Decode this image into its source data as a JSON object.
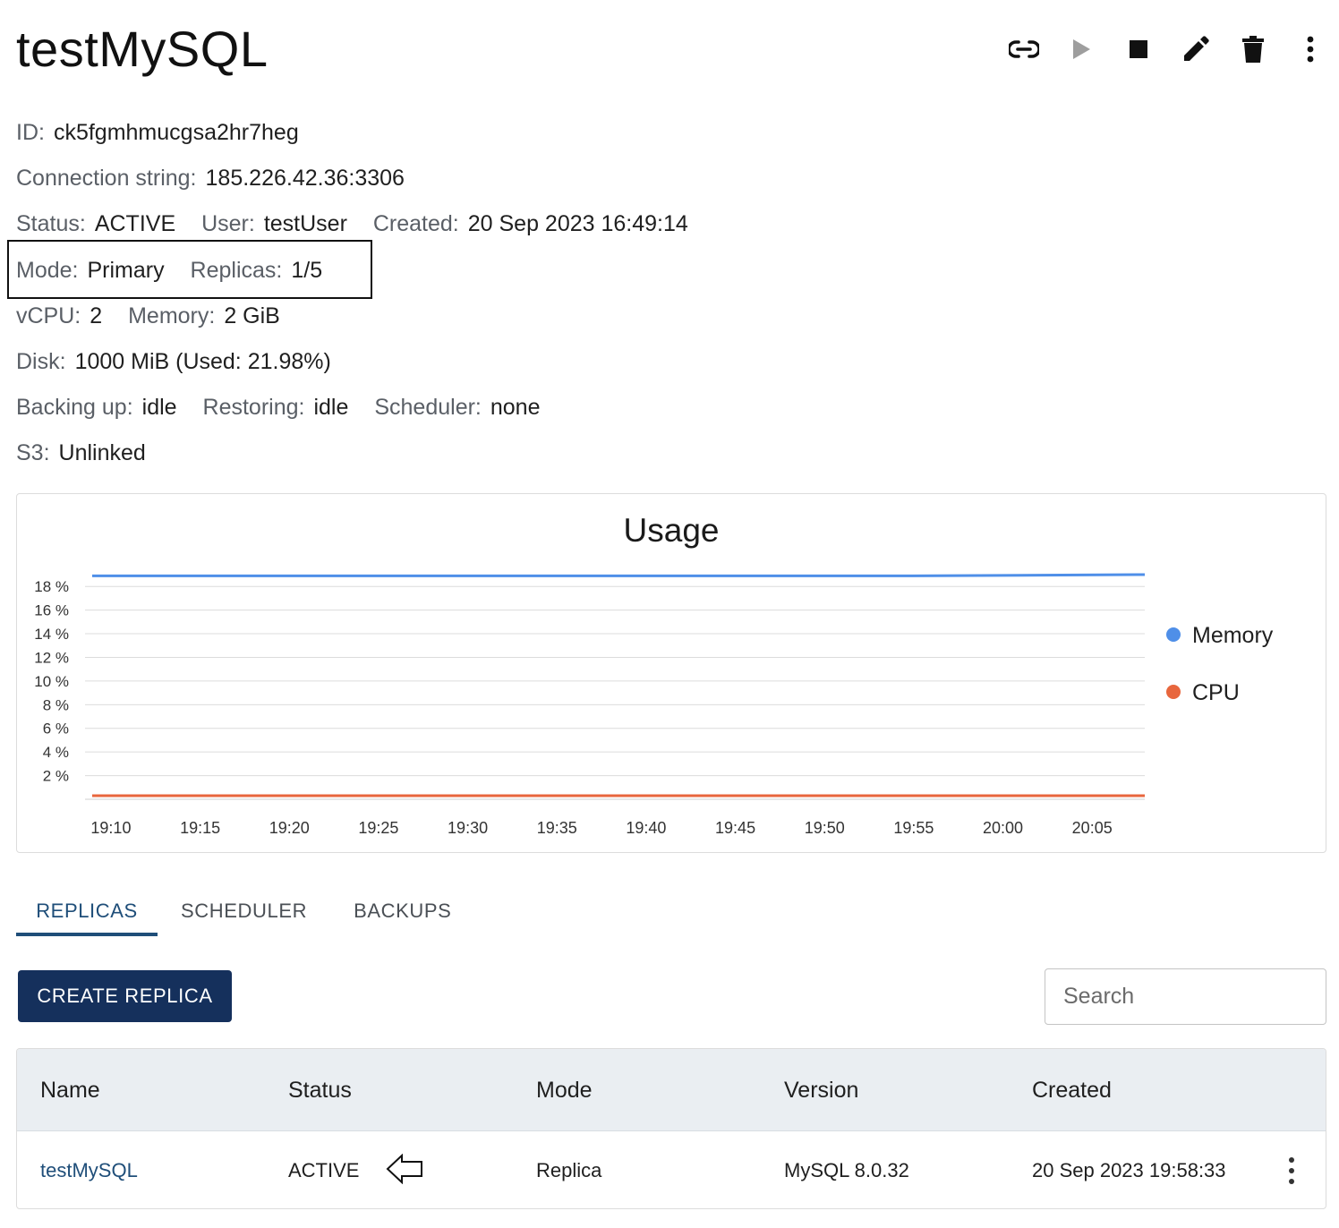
{
  "header": {
    "title": "testMySQL",
    "actions": [
      {
        "name": "link-icon",
        "label": "link"
      },
      {
        "name": "play-icon",
        "label": "start"
      },
      {
        "name": "stop-icon",
        "label": "stop"
      },
      {
        "name": "pencil-icon",
        "label": "edit"
      },
      {
        "name": "trash-icon",
        "label": "delete"
      },
      {
        "name": "more-vert-icon",
        "label": "more"
      }
    ]
  },
  "details": {
    "id_label": "ID:",
    "id_value": "ck5fgmhmucgsa2hr7heg",
    "conn_label": "Connection string:",
    "conn_value": "185.226.42.36:3306",
    "status_label": "Status:",
    "status_value": "ACTIVE",
    "user_label": "User:",
    "user_value": "testUser",
    "created_label": "Created:",
    "created_value": "20 Sep 2023 16:49:14",
    "mode_label": "Mode:",
    "mode_value": "Primary",
    "replicas_label": "Replicas:",
    "replicas_value": "1/5",
    "vcpu_label": "vCPU:",
    "vcpu_value": "2",
    "memory_label": "Memory:",
    "memory_value": "2 GiB",
    "disk_label": "Disk:",
    "disk_value": "1000 MiB (Used: 21.98%)",
    "backing_label": "Backing up:",
    "backing_value": "idle",
    "restoring_label": "Restoring:",
    "restoring_value": "idle",
    "scheduler_label": "Scheduler:",
    "scheduler_value": "none",
    "s3_label": "S3:",
    "s3_value": "Unlinked"
  },
  "chart_data": {
    "type": "line",
    "title": "Usage",
    "x_ticks": [
      "19:10",
      "19:15",
      "19:20",
      "19:25",
      "19:30",
      "19:35",
      "19:40",
      "19:45",
      "19:50",
      "19:55",
      "20:00",
      "20:05"
    ],
    "y_ticks": [
      "2 %",
      "4 %",
      "6 %",
      "8 %",
      "10 %",
      "12 %",
      "14 %",
      "16 %",
      "18 %"
    ],
    "ylim": [
      0,
      19
    ],
    "xlim": [
      9,
      68
    ],
    "grid": true,
    "legend_position": "right",
    "series": [
      {
        "name": "Memory",
        "color": "#4f8fe8",
        "x": [
          9,
          55,
          68
        ],
        "values": [
          18.9,
          18.9,
          19.0
        ]
      },
      {
        "name": "CPU",
        "color": "#e8663d",
        "x": [
          9,
          12,
          16,
          20,
          24,
          28,
          32,
          36,
          40,
          44,
          48,
          52,
          56,
          60,
          64,
          68
        ],
        "values": [
          0.3,
          0.3,
          0.3,
          0.3,
          0.3,
          0.3,
          0.3,
          0.3,
          0.3,
          0.3,
          0.3,
          0.3,
          0.3,
          0.3,
          0.3,
          0.3
        ]
      }
    ]
  },
  "tabs": [
    {
      "label": "REPLICAS",
      "active": true
    },
    {
      "label": "SCHEDULER",
      "active": false
    },
    {
      "label": "BACKUPS",
      "active": false
    }
  ],
  "create_button": "CREATE REPLICA",
  "search": {
    "placeholder": "Search"
  },
  "table": {
    "columns": [
      "Name",
      "Status",
      "Mode",
      "Version",
      "Created"
    ],
    "rows": [
      {
        "name": "testMySQL",
        "status": "ACTIVE",
        "mode": "Replica",
        "version": "MySQL 8.0.32",
        "created": "20 Sep 2023 19:58:33"
      }
    ]
  }
}
